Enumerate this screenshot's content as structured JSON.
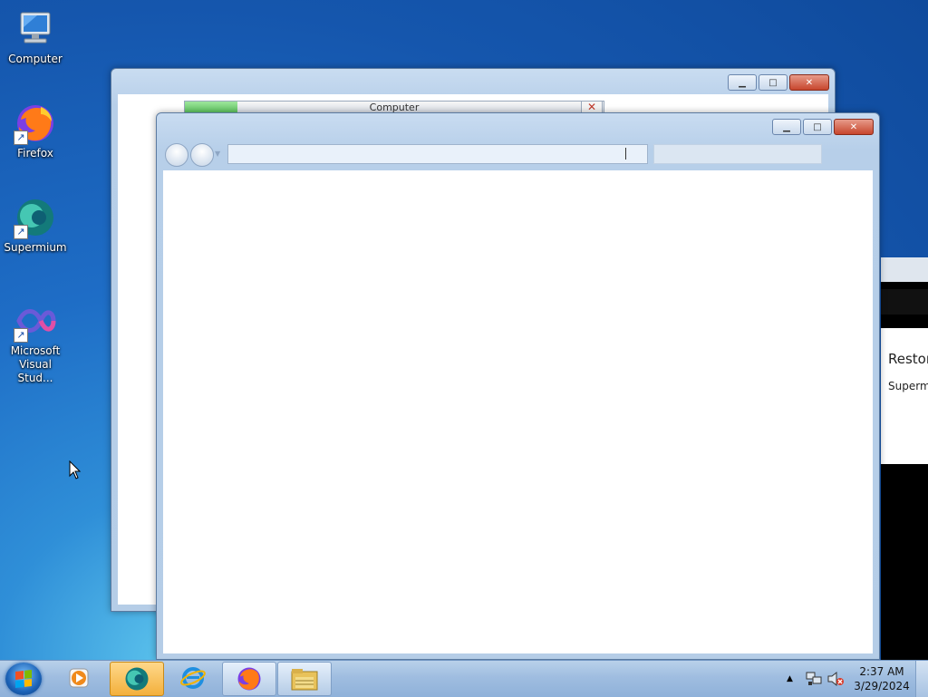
{
  "desktop": {
    "icons": [
      {
        "label": "Computer",
        "icon": "computer-icon"
      },
      {
        "label": "Firefox",
        "icon": "firefox-icon"
      },
      {
        "label": "Supermium",
        "icon": "supermium-icon"
      },
      {
        "label": "Microsoft Visual Stud...",
        "icon": "visual-studio-icon"
      }
    ]
  },
  "back_window": {
    "address_label": "Computer",
    "stop_label": "✕"
  },
  "front_window": {
    "address_value": "",
    "search_value": ""
  },
  "right_window": {
    "heading": "Restor",
    "subtext": "Supermi"
  },
  "taskbar": {
    "items": [
      {
        "name": "media-player",
        "icon": "media-player-icon"
      },
      {
        "name": "supermium",
        "icon": "supermium-icon",
        "active": true
      },
      {
        "name": "internet-explorer",
        "icon": "internet-explorer-icon"
      },
      {
        "name": "firefox",
        "icon": "firefox-icon"
      },
      {
        "name": "explorer",
        "icon": "folder-icon"
      }
    ],
    "clock_time": "2:37 AM",
    "clock_date": "3/29/2024"
  },
  "colors": {
    "accent": "#1556ad",
    "taskbar": "#9fbde0",
    "active_item": "#f3b03c"
  }
}
